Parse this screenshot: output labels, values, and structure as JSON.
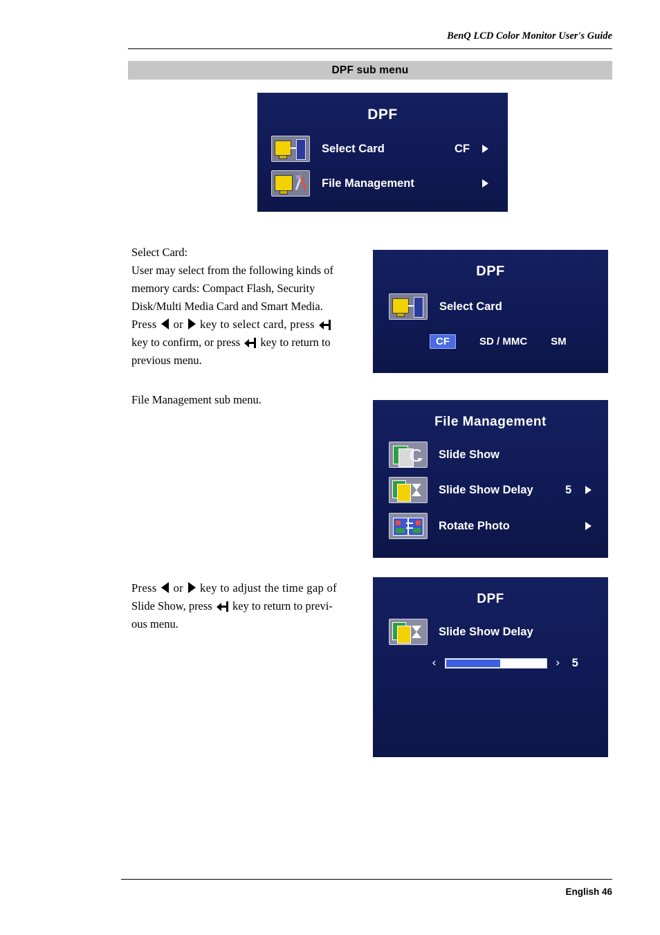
{
  "header": {
    "text": "BenQ LCD Color Monitor User's Guide"
  },
  "title_bar": {
    "text": "DPF sub menu"
  },
  "osd_dpf_main": {
    "title": "DPF",
    "rows": [
      {
        "label": "Select Card",
        "value": "CF",
        "icon": "select-card-icon",
        "arrow": "▶"
      },
      {
        "label": "File Management",
        "value": "",
        "icon": "file-management-icon",
        "arrow": "▶"
      }
    ]
  },
  "osd_select_card": {
    "title": "DPF",
    "row_label": "Select Card",
    "icon": "select-card-icon",
    "options": [
      "CF",
      "SD / MMC",
      "SM"
    ],
    "selected": "CF"
  },
  "osd_file_management": {
    "title": "File Management",
    "rows": [
      {
        "label": "Slide Show",
        "value": "",
        "arrow": "",
        "icon": "slide-show-icon"
      },
      {
        "label": "Slide Show Delay",
        "value": "5",
        "arrow": "▶",
        "icon": "slide-show-delay-icon"
      },
      {
        "label": "Rotate Photo",
        "value": "",
        "arrow": "▶",
        "icon": "rotate-photo-icon"
      }
    ]
  },
  "osd_slide_show_delay": {
    "title": "DPF",
    "row_label": "Slide Show Delay",
    "icon": "slide-show-delay-icon",
    "left_arrow": "‹",
    "right_arrow": "›",
    "value": "5",
    "slider_percent": 55
  },
  "body": {
    "select_card_heading": "Select Card:",
    "select_card_line1": "User may select from the following kinds of",
    "select_card_line2": "memory cards: Compact Flash, Security",
    "select_card_line3": "Disk/Multi Media Card and Smart Media.",
    "press_word": "Press",
    "or_word": "or",
    "select_card_line4_a": "key to select card, press",
    "select_card_line5_a": "key to confirm, or press",
    "select_card_line5_b": "key to return to",
    "select_card_line6": "previous menu.",
    "file_management_note": "File Management sub menu.",
    "delay_line1_a": "key to adjust the time gap of",
    "delay_line2_a": "Slide Show, press",
    "delay_line2_b": "key to return to previ-",
    "delay_line3": "ous menu."
  },
  "footer": {
    "text": "English  46"
  }
}
